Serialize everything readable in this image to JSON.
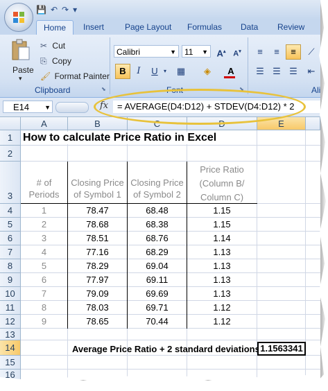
{
  "quick_access": [
    "💾",
    "↶",
    "↷",
    "▾"
  ],
  "tabs": [
    "Home",
    "Insert",
    "Page Layout",
    "Formulas",
    "Data",
    "Review"
  ],
  "clipboard": {
    "paste": "Paste",
    "cut": "Cut",
    "copy": "Copy",
    "format_painter": "Format Painter",
    "group": "Clipboard"
  },
  "font": {
    "name": "Calibri",
    "size": "11",
    "group": "Font",
    "bold": "B",
    "italic": "I",
    "underline": "U"
  },
  "alignment_group": "Alig",
  "formula_bar": {
    "name_box": "E14",
    "fx": "fx",
    "formula": "= AVERAGE(D4:D12) + STDEV(D4:D12) * 2"
  },
  "columns": [
    "A",
    "B",
    "C",
    "D",
    "E"
  ],
  "rows": [
    "1",
    "2",
    "3",
    "4",
    "5",
    "6",
    "7",
    "8",
    "9",
    "10",
    "11",
    "12",
    "13",
    "14",
    "15",
    "16"
  ],
  "sheet": {
    "title": "How to calculate Price Ratio in Excel",
    "headers": {
      "a": [
        "# of",
        "Periods"
      ],
      "b": [
        "Closing Price",
        "of Symbol 1"
      ],
      "c": [
        "Closing Price",
        "of Symbol 2"
      ],
      "d": [
        "Price Ratio",
        "(Column B/",
        "Column C)"
      ]
    },
    "data": [
      [
        "1",
        "78.47",
        "68.48",
        "1.15"
      ],
      [
        "2",
        "78.68",
        "68.38",
        "1.15"
      ],
      [
        "3",
        "78.51",
        "68.76",
        "1.14"
      ],
      [
        "4",
        "77.16",
        "68.29",
        "1.13"
      ],
      [
        "5",
        "78.29",
        "69.04",
        "1.13"
      ],
      [
        "6",
        "77.97",
        "69.11",
        "1.13"
      ],
      [
        "7",
        "79.09",
        "69.69",
        "1.13"
      ],
      [
        "8",
        "78.03",
        "69.71",
        "1.12"
      ],
      [
        "9",
        "78.65",
        "70.44",
        "1.12"
      ]
    ],
    "summary_label": "Average Price Ratio + 2 standard deviations",
    "summary_value": "1.1563341"
  },
  "colors": {
    "highlight": "#e8c23b",
    "ribbon": "#d5e2f3",
    "selected_header": "#f8c969"
  }
}
